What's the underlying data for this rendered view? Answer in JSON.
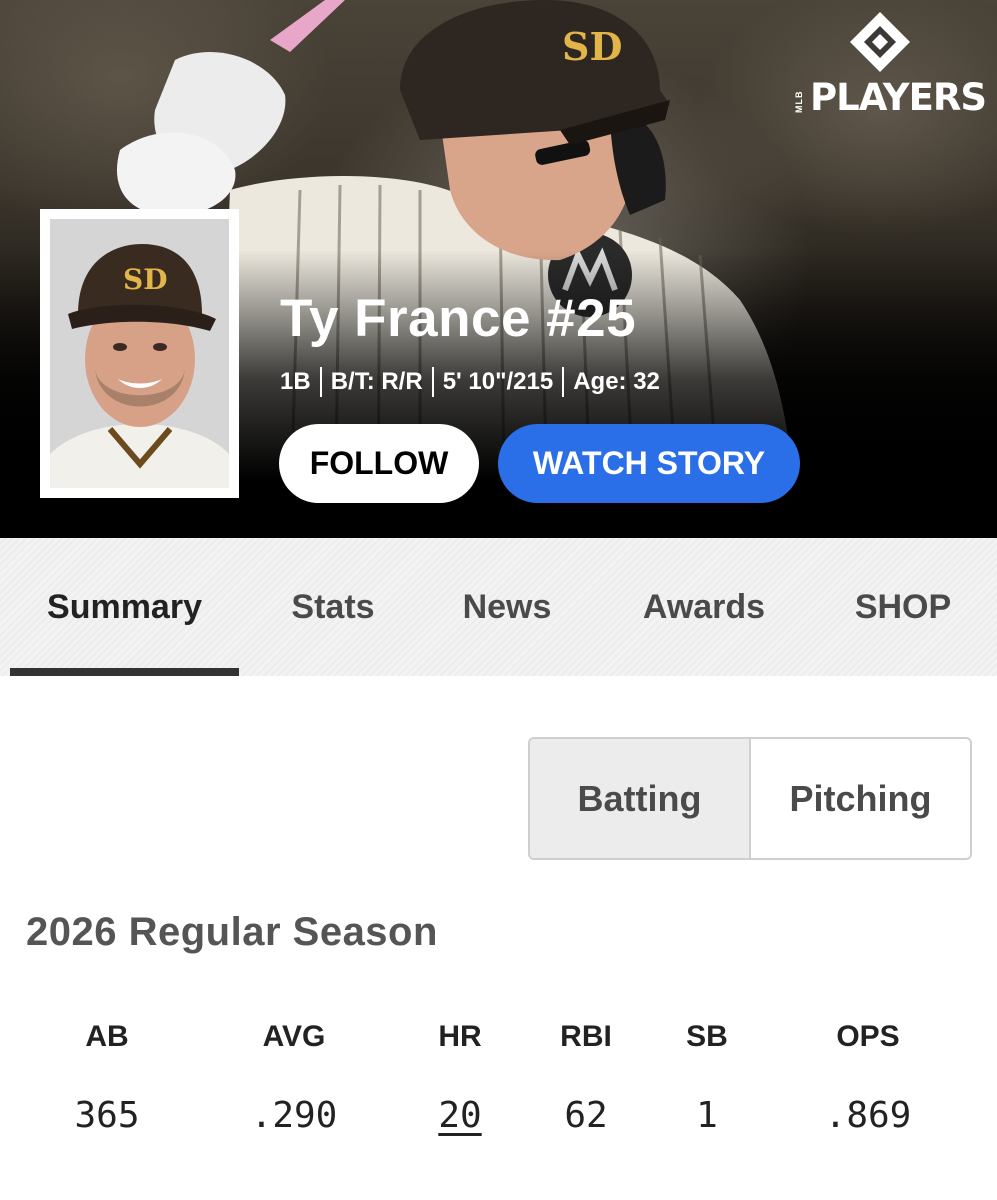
{
  "brand": {
    "mlb": "MLB",
    "players": "PLAYERS"
  },
  "player": {
    "name": "Ty France #25",
    "position": "1B",
    "bats_throws": "B/T: R/R",
    "height_weight": "5' 10\"/215",
    "age": "Age: 32",
    "cap_logo": "SD"
  },
  "actions": {
    "follow": "FOLLOW",
    "watch_story": "WATCH STORY"
  },
  "colors": {
    "accent_blue": "#2a6fe8",
    "hero_bg": "#000000"
  },
  "tabs": [
    {
      "label": "Summary",
      "active": true
    },
    {
      "label": "Stats",
      "active": false
    },
    {
      "label": "News",
      "active": false
    },
    {
      "label": "Awards",
      "active": false
    },
    {
      "label": "SHOP",
      "active": false
    }
  ],
  "stat_type": {
    "options": [
      "Batting",
      "Pitching"
    ],
    "selected": "Batting"
  },
  "season": {
    "title": "2026 Regular Season"
  },
  "stats": {
    "headers": [
      "AB",
      "AVG",
      "HR",
      "RBI",
      "SB",
      "OPS"
    ],
    "values": [
      "365",
      ".290",
      "20",
      "62",
      "1",
      ".869"
    ]
  }
}
